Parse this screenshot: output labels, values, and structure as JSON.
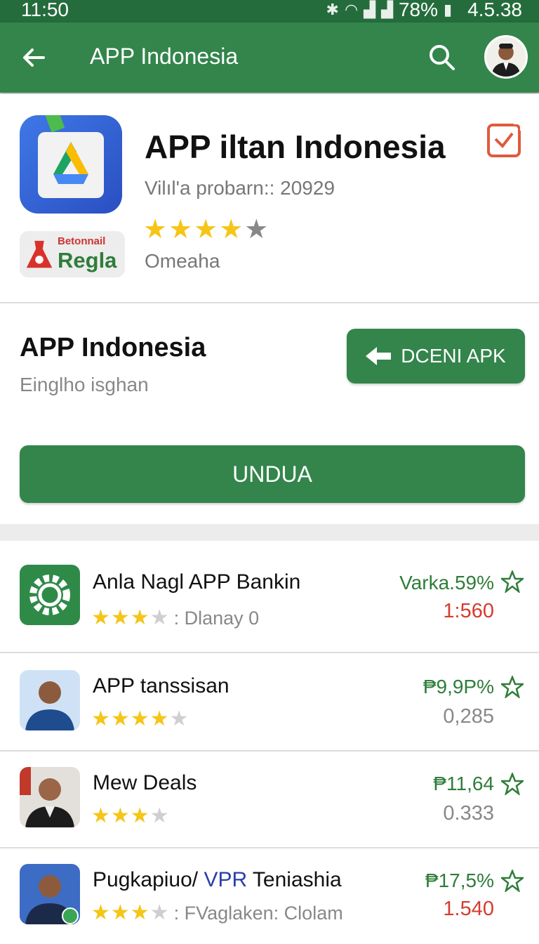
{
  "status_bar": {
    "time": "11:50",
    "battery": "78%",
    "network_version": "4.5.38"
  },
  "app_bar": {
    "title": "APP Indonesia",
    "back_icon": "arrow-left-icon",
    "search_icon": "search-icon"
  },
  "app_header": {
    "title": "APP iltan Indonesia",
    "subtitle": "Vilıl'a probarn:: 20929",
    "rating": 4.5,
    "developer": "Omeaha",
    "badge_small": "Betonnail",
    "badge_big": "Regla"
  },
  "section": {
    "title": "APP Indonesia",
    "subtitle": "Einglho isghan",
    "apk_button": "DCENI APK",
    "download_button": "UNDUA"
  },
  "list": [
    {
      "name": "Anla Nagl  APP Bankin",
      "stars": 3,
      "note": ": Dlanay 0",
      "pct": "Varka.59%",
      "value": "1:560",
      "value_color": "red"
    },
    {
      "name": "APP tanssisan",
      "stars": 4,
      "note": "",
      "pct": "₱9,9P%",
      "value": "0,285",
      "value_color": "gray"
    },
    {
      "name": "Mew Deals",
      "stars": 3,
      "note": "",
      "pct": "₱11,64",
      "value": "0.333",
      "value_color": "gray"
    },
    {
      "name_pre": "Pugkapiuo/ ",
      "name_vpr": "VPR",
      "name_post": " Teniashia",
      "stars": 3,
      "note": ": FVaglaken: Clolam",
      "pct": "₱17,5%",
      "value": "1.540",
      "value_color": "red"
    }
  ],
  "colors": {
    "primary": "#33854b",
    "status": "#256c3c",
    "star": "#f5c518",
    "positive": "#2f7d3a",
    "negative": "#d63b2f"
  }
}
